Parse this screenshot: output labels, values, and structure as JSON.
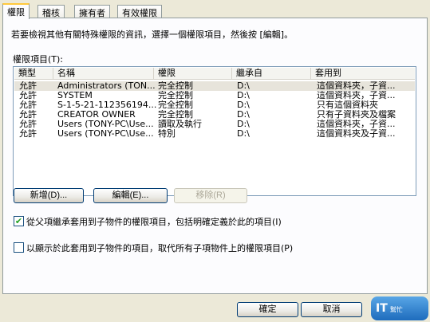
{
  "tabs": [
    {
      "label": "權限"
    },
    {
      "label": "稽核"
    },
    {
      "label": "擁有者"
    },
    {
      "label": "有效權限"
    }
  ],
  "description": "若要檢視其他有關特殊權限的資訊，選擇一個權限項目，然後按 [編輯]。",
  "entries_label": "權限項目(T):",
  "columns": [
    "類型",
    "名稱",
    "權限",
    "繼承自",
    "套用到"
  ],
  "rows": [
    {
      "type": "允許",
      "name": "Administrators (TON...",
      "permission": "完全控制",
      "inherited": "D:\\",
      "applies": "這個資料夾，子資..."
    },
    {
      "type": "允許",
      "name": "SYSTEM",
      "permission": "完全控制",
      "inherited": "D:\\",
      "applies": "這個資料夾，子資..."
    },
    {
      "type": "允許",
      "name": "S-1-5-21-112356194...",
      "permission": "完全控制",
      "inherited": "D:\\",
      "applies": "只有這個資料夾"
    },
    {
      "type": "允許",
      "name": "CREATOR OWNER",
      "permission": "完全控制",
      "inherited": "D:\\",
      "applies": "只有子資料夾及檔案"
    },
    {
      "type": "允許",
      "name": "Users (TONY-PC\\Use...",
      "permission": "讀取及執行",
      "inherited": "D:\\",
      "applies": "這個資料夾，子資..."
    },
    {
      "type": "允許",
      "name": "Users (TONY-PC\\Use...",
      "permission": "特別",
      "inherited": "D:\\",
      "applies": "這個資料夾及子資..."
    }
  ],
  "buttons": {
    "add": "新增(D)...",
    "edit": "編輯(E)...",
    "remove": "移除(R)",
    "ok": "確定",
    "cancel": "取消"
  },
  "checkboxes": {
    "inherit": {
      "label": "從父項繼承套用到子物件的權限項目，包括明確定義於此的項目(I)",
      "checked": true
    },
    "replace": {
      "label": "以顯示於此套用到子物件的項目，取代所有子項物件上的權限項目(P)",
      "checked": false
    }
  },
  "watermark": {
    "text": "IT",
    "sub": "幫忙"
  }
}
